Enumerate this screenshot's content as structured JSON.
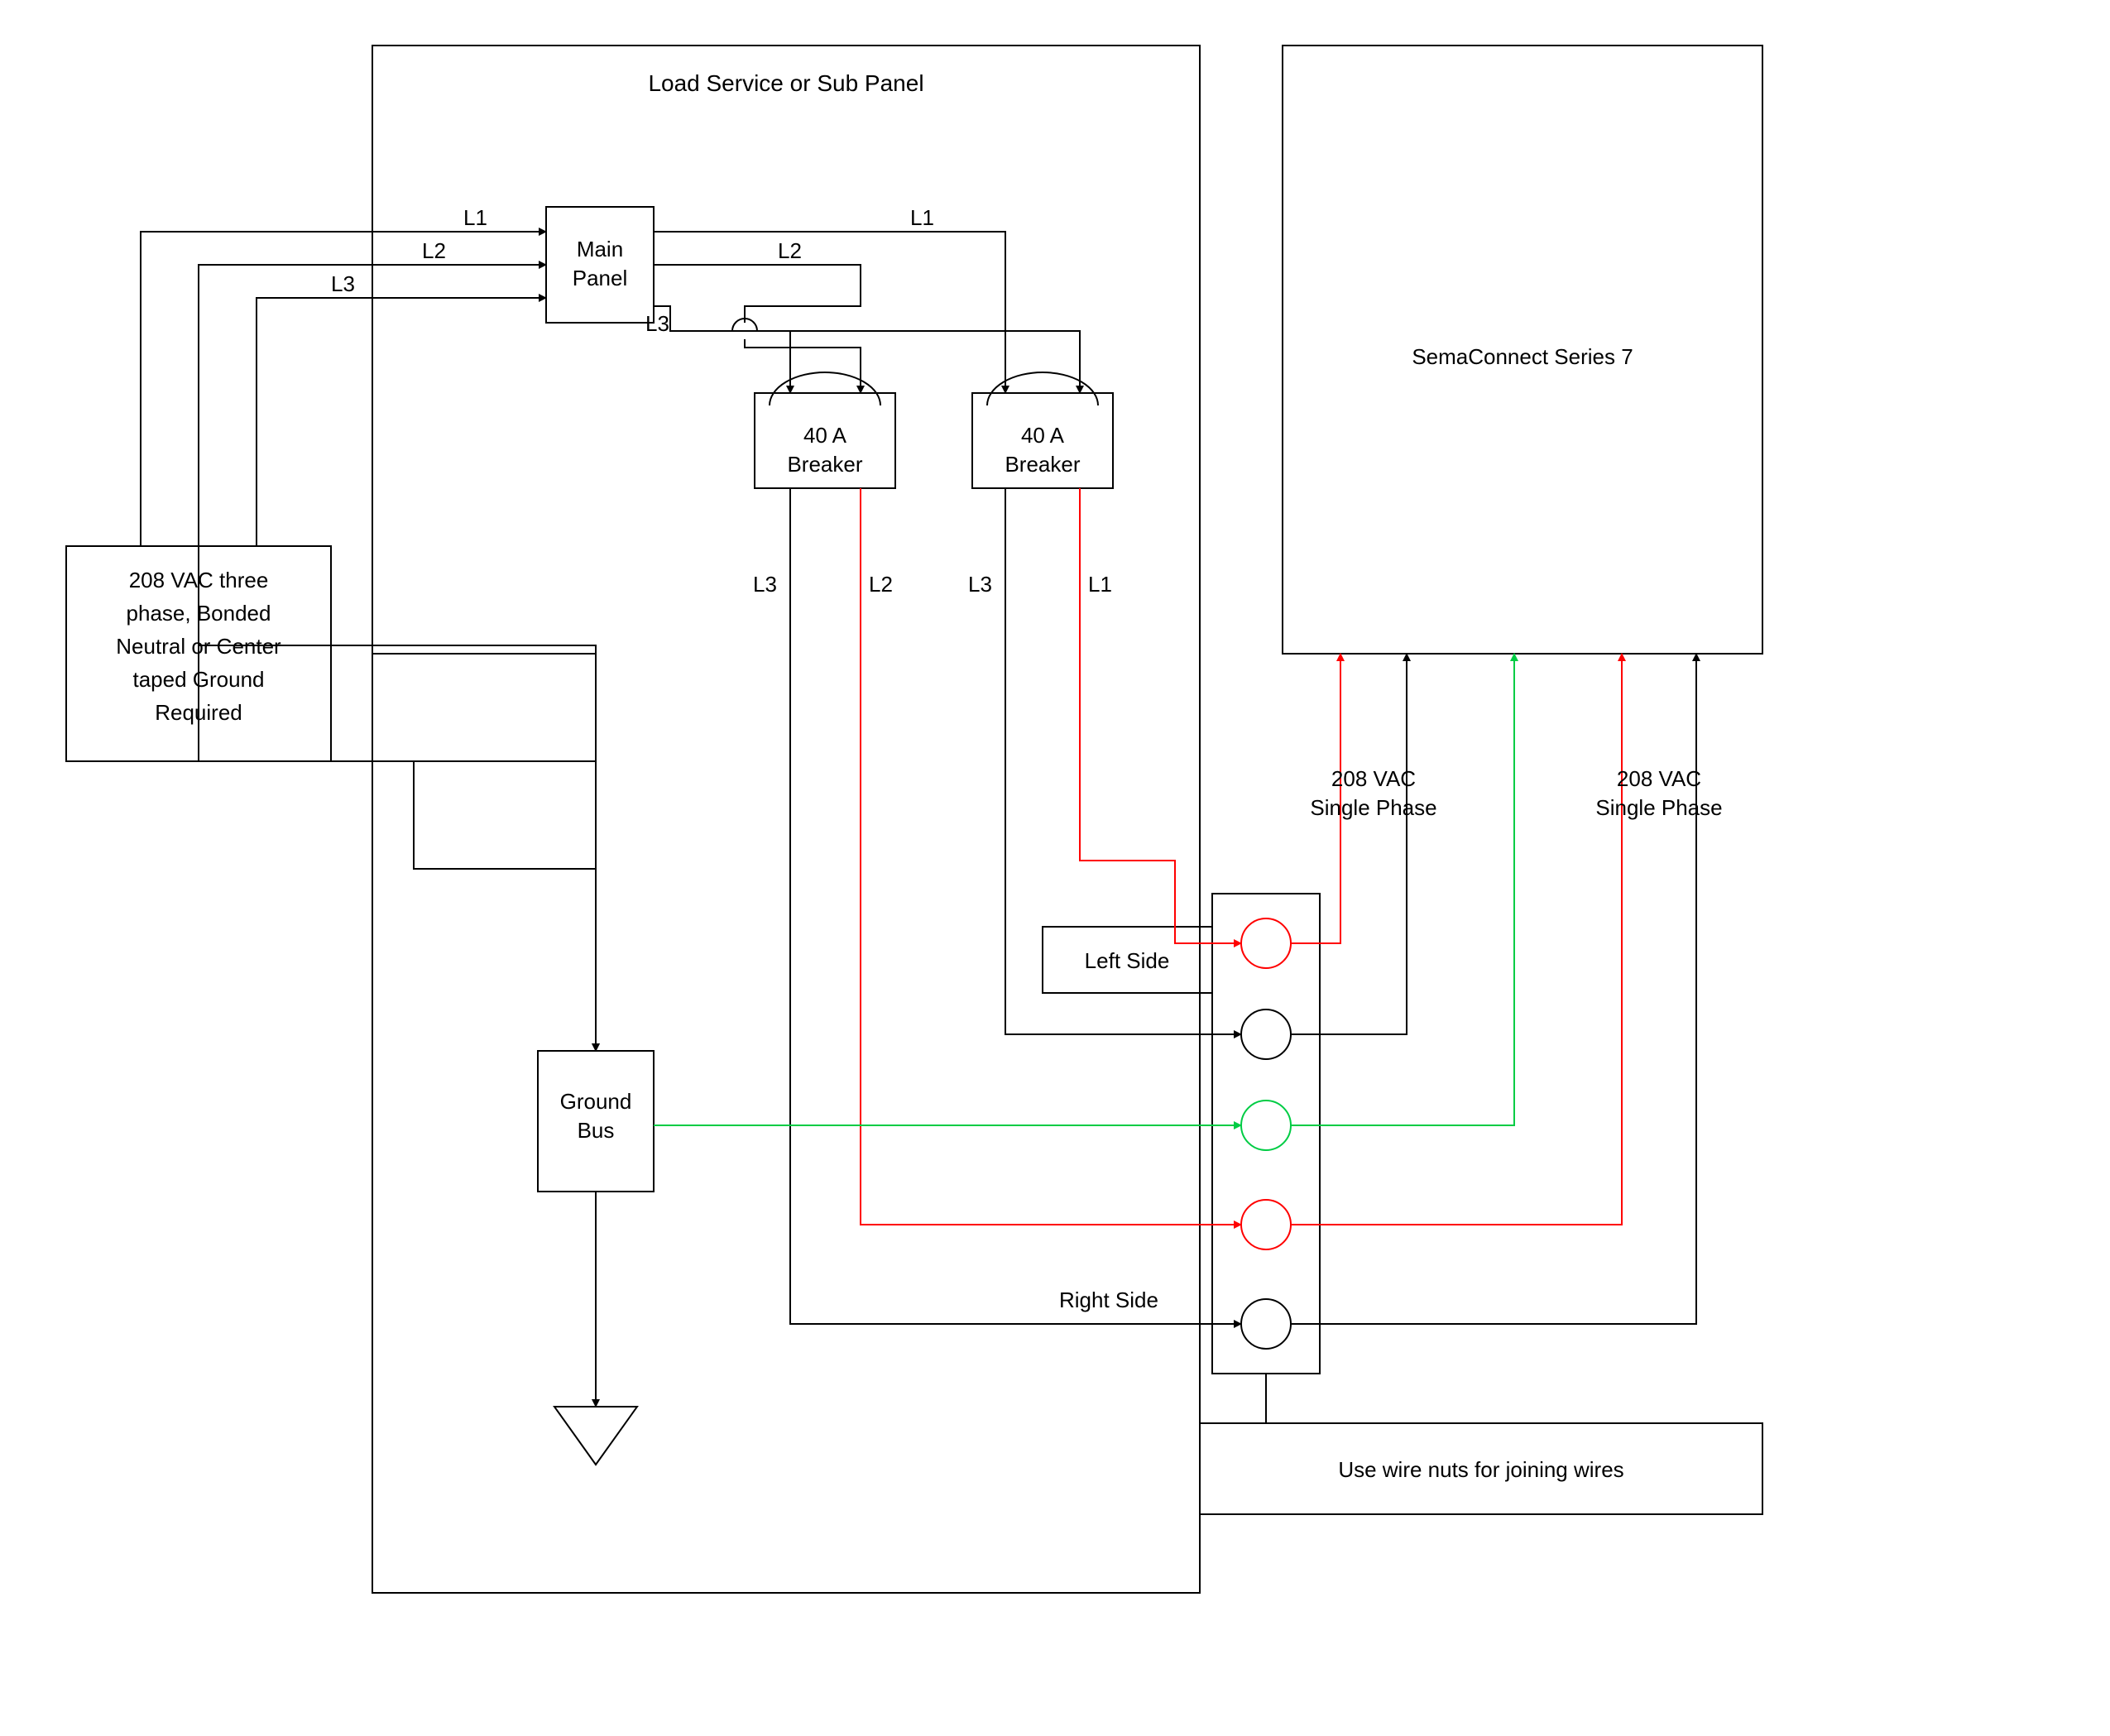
{
  "title": "Load Service or Sub Panel",
  "source": {
    "line1": "208 VAC three",
    "line2": "phase, Bonded",
    "line3": "Neutral or Center",
    "line4": "taped Ground",
    "line5": "Required"
  },
  "main_panel": {
    "line1": "Main",
    "line2": "Panel"
  },
  "breaker1": {
    "rating": "40 A",
    "label": "Breaker"
  },
  "breaker2": {
    "rating": "40 A",
    "label": "Breaker"
  },
  "ground": {
    "line1": "Ground",
    "line2": "Bus"
  },
  "device": "SemaConnect Series 7",
  "phase_left": {
    "line1": "208 VAC",
    "line2": "Single Phase"
  },
  "phase_right": {
    "line1": "208 VAC",
    "line2": "Single Phase"
  },
  "side_left": "Left Side",
  "side_right": "Right Side",
  "note": "Use wire nuts for joining wires",
  "L1": "L1",
  "L2": "L2",
  "L3": "L3",
  "colors": {
    "red": "#ff0000",
    "green": "#00cc44",
    "black": "#000000"
  }
}
